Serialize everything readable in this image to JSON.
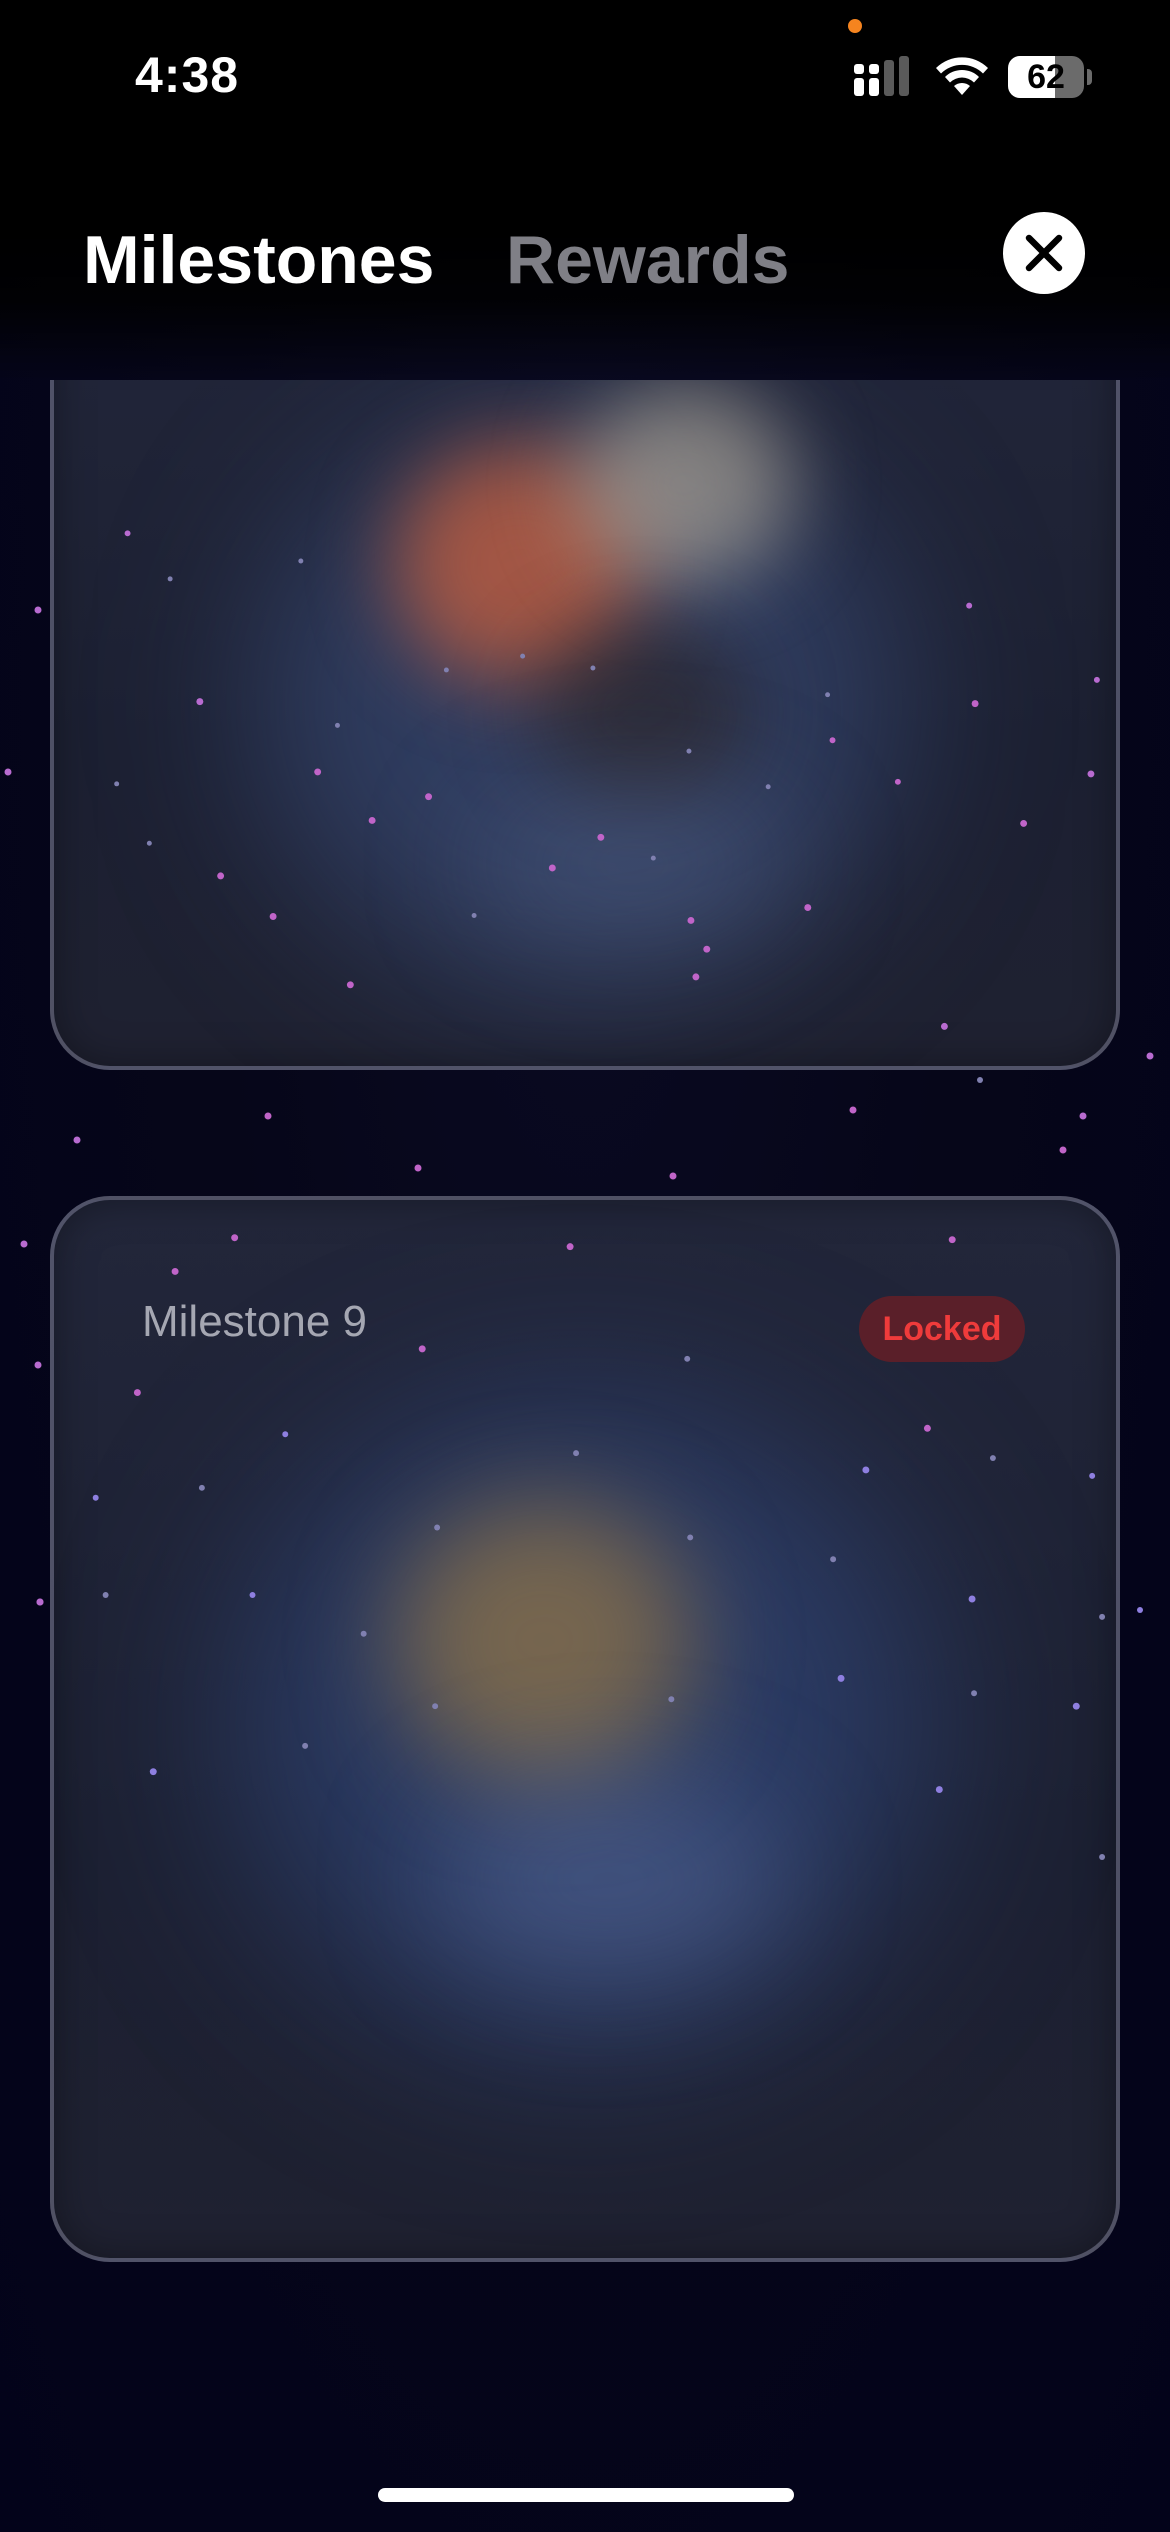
{
  "status_bar": {
    "time": "4:38",
    "battery_level": "62",
    "battery_fraction": 0.62,
    "icons": [
      "signal-icon",
      "wifi-icon",
      "battery-icon"
    ],
    "privacy_indicator_color": "#f5841f"
  },
  "header": {
    "tabs": [
      {
        "label": "Milestones",
        "active": true
      },
      {
        "label": "Rewards",
        "active": false
      }
    ],
    "close_icon": "close-icon"
  },
  "milestones": [
    {
      "title": "",
      "status": ""
    },
    {
      "title": "Milestone 9",
      "status": "Locked"
    }
  ],
  "colors": {
    "background": "#060619",
    "active_tab": "#ffffff",
    "inactive_tab": "#7f7f86",
    "locked_text": "#ef3b3b",
    "locked_badge_bg": "#5a1f29"
  }
}
